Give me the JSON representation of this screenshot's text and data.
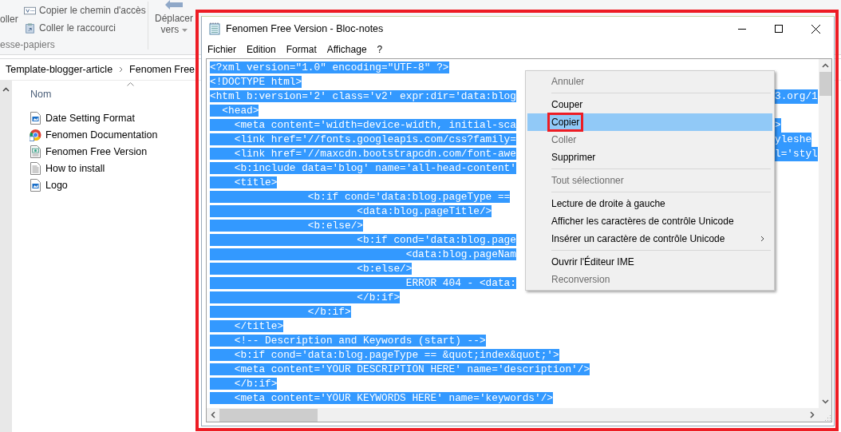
{
  "explorer": {
    "ribbon": {
      "paste_label": "oller",
      "small_buttons": [
        {
          "kind": "path",
          "label": "Copier le chemin d'accès"
        },
        {
          "kind": "shortcut",
          "label": "Coller le raccourci"
        }
      ],
      "group_label": "esse-papiers",
      "move_button": {
        "label": "Déplacer",
        "sublabel": "vers"
      }
    },
    "breadcrumb": [
      "Template-blogger-article",
      "Fenomen Free"
    ],
    "column": {
      "label": "Nom"
    },
    "files": [
      {
        "name": "Date Setting Format",
        "kind": "image"
      },
      {
        "name": "Fenomen Documentation",
        "kind": "browser"
      },
      {
        "name": "Fenomen Free Version",
        "kind": "html"
      },
      {
        "name": "How to install",
        "kind": "text"
      },
      {
        "name": "Logo",
        "kind": "image"
      }
    ]
  },
  "notepad": {
    "title": "Fenomen Free Version - Bloc-notes",
    "annotated": true,
    "menu": [
      "Fichier",
      "Edition",
      "Format",
      "Affichage",
      "?"
    ],
    "editor": {
      "text_selected": true,
      "lines": [
        {
          "text": "<?xml version=\"1.0\" encoding=\"UTF-8\" ?>"
        },
        {
          "text": "<!DOCTYPE html>"
        },
        {
          "text": "<html b:version='2' class='v2' expr:dir='data:blog",
          "tail": "3.org/1"
        },
        {
          "text": "  <head>"
        },
        {
          "text": "    <meta content='width=device-width, initial-sca",
          "tail": ">"
        },
        {
          "text": "    <link href='//fonts.googleapis.com/css?family=",
          "tail": "yleshe"
        },
        {
          "text": "    <link href='//maxcdn.bootstrapcdn.com/font-awe",
          "tail": "l='styl"
        },
        {
          "text": "    <b:include data='blog' name='all-head-content'"
        },
        {
          "text": "    <title>"
        },
        {
          "text": "                <b:if cond='data:blog.pageType =="
        },
        {
          "text": "                        <data:blog.pageTitle/>"
        },
        {
          "text": "                <b:else/>"
        },
        {
          "text": "                        <b:if cond='data:blog.page"
        },
        {
          "text": "                                <data:blog.pageNam"
        },
        {
          "text": "                        <b:else/>"
        },
        {
          "text": "                                ERROR 404 - <data:"
        },
        {
          "text": "                        </b:if>"
        },
        {
          "text": "                </b:if>"
        },
        {
          "text": "    </title>"
        },
        {
          "text": "    <!-- Description and Keywords (start) -->"
        },
        {
          "text": "    <b:if cond='data:blog.pageType == &quot;index&quot;'>"
        },
        {
          "text": "    <meta content='YOUR DESCRIPTION HERE' name='description'/>"
        },
        {
          "text": "    </b:if>"
        },
        {
          "text": "    <meta content='YOUR KEYWORDS HERE' name='keywords'/>"
        }
      ]
    }
  },
  "context_menu": {
    "items": [
      {
        "kind": "item",
        "label": "Annuler",
        "disabled": true,
        "selected": false
      },
      {
        "kind": "separator"
      },
      {
        "kind": "item",
        "label": "Couper",
        "disabled": false,
        "selected": false
      },
      {
        "kind": "item",
        "label": "Copier",
        "disabled": false,
        "selected": true,
        "annotated": true
      },
      {
        "kind": "item",
        "label": "Coller",
        "disabled": true,
        "selected": false
      },
      {
        "kind": "item",
        "label": "Supprimer",
        "disabled": false,
        "selected": false
      },
      {
        "kind": "separator"
      },
      {
        "kind": "item",
        "label": "Tout sélectionner",
        "disabled": true,
        "selected": false
      },
      {
        "kind": "separator"
      },
      {
        "kind": "item",
        "label": "Lecture de droite à gauche",
        "disabled": false,
        "selected": false
      },
      {
        "kind": "item",
        "label": "Afficher les caractères de contrôle Unicode",
        "disabled": false,
        "selected": false
      },
      {
        "kind": "item",
        "label": "Insérer un caractère de contrôle Unicode",
        "disabled": false,
        "selected": false,
        "submenu": true
      },
      {
        "kind": "separator"
      },
      {
        "kind": "item",
        "label": "Ouvrir l'Éditeur IME",
        "disabled": false,
        "selected": false
      },
      {
        "kind": "item",
        "label": "Reconversion",
        "disabled": true,
        "selected": false
      }
    ]
  }
}
